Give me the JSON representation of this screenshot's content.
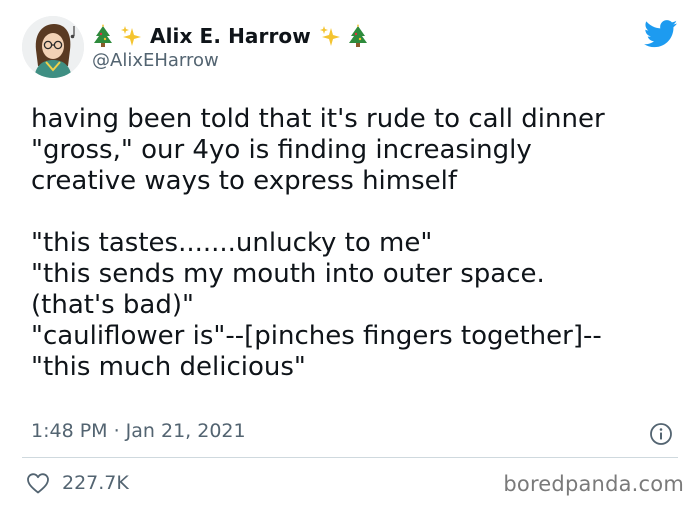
{
  "user": {
    "display_name": "Alix E. Harrow",
    "handle": "@AlixEHarrow",
    "name_emojis_left": [
      "christmas-tree",
      "sparkles"
    ],
    "name_emojis_right": [
      "sparkles",
      "christmas-tree"
    ]
  },
  "tweet": {
    "text": "having been told that it's rude to call dinner\n\"gross,\" our 4yo is finding increasingly\ncreative ways to express himself\n\n\"this tastes.......unlucky to me\"\n\"this sends my mouth into outer space.\n(that's bad)\"\n\"cauliflower is\"--[pinches fingers together]--\n\"this much delicious\"",
    "timestamp": "1:48 PM · Jan 21, 2021"
  },
  "stats": {
    "likes": "227.7K"
  },
  "watermark": "boredpanda.com",
  "colors": {
    "twitter_blue": "#1d9bf0",
    "secondary_text": "#536471",
    "primary_text": "#0f1419",
    "divider": "#cfd9de"
  },
  "icons": [
    "avatar",
    "christmas-tree-icon",
    "sparkles-icon",
    "twitter-bird-icon",
    "info-icon",
    "heart-icon"
  ]
}
